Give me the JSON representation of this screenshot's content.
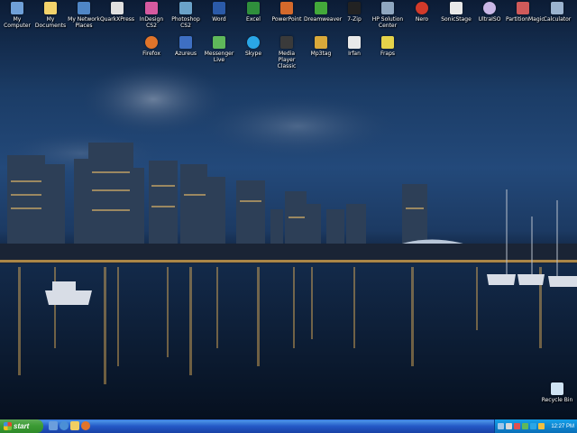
{
  "desktop": {
    "icons_row1": [
      {
        "label": "My Computer",
        "icon": "computer-icon",
        "color": "#6fa0d8"
      },
      {
        "label": "My Documents",
        "icon": "folder-icon",
        "color": "#f3d36b"
      },
      {
        "label": "My Network Places",
        "icon": "network-icon",
        "color": "#4f86c6"
      },
      {
        "label": "QuarkXPress",
        "icon": "quark-icon",
        "color": "#e0e0e0"
      },
      {
        "label": "InDesign CS2",
        "icon": "indesign-icon",
        "color": "#d65aa0"
      },
      {
        "label": "Photoshop CS2",
        "icon": "photoshop-icon",
        "color": "#6aa2c9"
      },
      {
        "label": "Word",
        "icon": "word-icon",
        "color": "#2b5aa8"
      },
      {
        "label": "Excel",
        "icon": "excel-icon",
        "color": "#2f8f3c"
      },
      {
        "label": "PowerPoint",
        "icon": "powerpoint-icon",
        "color": "#d4692b"
      },
      {
        "label": "Dreamweaver",
        "icon": "dreamweaver-icon",
        "color": "#43a93a"
      },
      {
        "label": "7-Zip",
        "icon": "zip-icon",
        "color": "#222222"
      },
      {
        "label": "HP Solution Center",
        "icon": "hp-icon",
        "color": "#8fa7c0"
      },
      {
        "label": "Nero",
        "icon": "nero-icon",
        "color": "#d23a2a"
      },
      {
        "label": "SonicStage",
        "icon": "sonicstage-icon",
        "color": "#e8e8e8"
      },
      {
        "label": "UltraISO",
        "icon": "ultraiso-icon",
        "color": "#c9b7e6"
      },
      {
        "label": "PartitionMagic",
        "icon": "partitionmagic-icon",
        "color": "#d05a5a"
      },
      {
        "label": "Calculator",
        "icon": "calculator-icon",
        "color": "#9bb3cf"
      }
    ],
    "icons_row2": [
      {
        "label": "Firefox",
        "icon": "firefox-icon",
        "color": "#e0742a"
      },
      {
        "label": "Azureus",
        "icon": "azureus-icon",
        "color": "#3e6fc2"
      },
      {
        "label": "Messenger Live",
        "icon": "messenger-icon",
        "color": "#5fb85a"
      },
      {
        "label": "Skype",
        "icon": "skype-icon",
        "color": "#2aa6e6"
      },
      {
        "label": "Media Player Classic",
        "icon": "media-player-icon",
        "color": "#3a3a3a"
      },
      {
        "label": "Mp3tag",
        "icon": "mp3tag-icon",
        "color": "#d9a93a"
      },
      {
        "label": "Irfan",
        "icon": "irfanview-icon",
        "color": "#e9e9e9"
      },
      {
        "label": "Fraps",
        "icon": "fraps-icon",
        "color": "#e5d34a"
      }
    ],
    "recycle_bin": {
      "label": "Recycle Bin",
      "icon": "recycle-bin-icon",
      "color": "#cfe3f3"
    }
  },
  "taskbar": {
    "start_label": "start",
    "quick_launch": [
      {
        "icon": "show-desktop-icon",
        "color": "#6b9edc"
      },
      {
        "icon": "internet-explorer-icon",
        "color": "#4b8fd6"
      },
      {
        "icon": "folder-icon",
        "color": "#f1cf63"
      },
      {
        "icon": "firefox-icon",
        "color": "#e0742a"
      }
    ],
    "tray_icons": [
      {
        "icon": "network-tray-icon",
        "color": "#9fc7ea"
      },
      {
        "icon": "volume-icon",
        "color": "#d8d8d8"
      },
      {
        "icon": "security-icon",
        "color": "#e05050"
      },
      {
        "icon": "messenger-tray-icon",
        "color": "#5fb85a"
      },
      {
        "icon": "skype-tray-icon",
        "color": "#2aa6e6"
      },
      {
        "icon": "antivirus-icon",
        "color": "#f0c040"
      }
    ],
    "clock": "12:27 PM"
  }
}
